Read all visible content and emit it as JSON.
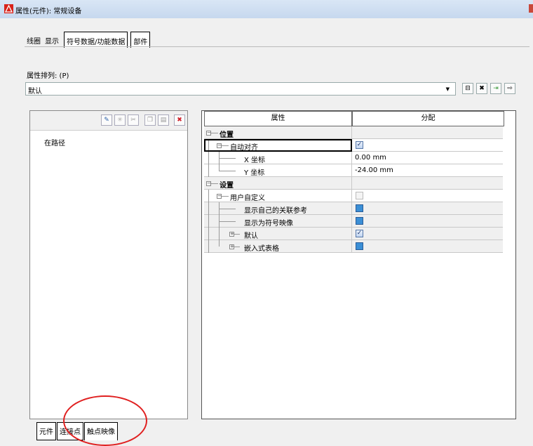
{
  "window": {
    "title": "属性(元件): 常规设备"
  },
  "tabs": [
    {
      "label": "线圈"
    },
    {
      "label": "显示"
    },
    {
      "label": "符号数据/功能数据"
    },
    {
      "label": "部件"
    }
  ],
  "attribute_sort": {
    "label": "属性排列: (P)",
    "value": "默认"
  },
  "left_panel": {
    "items": [
      "在路径"
    ]
  },
  "grid": {
    "headers": [
      "属性",
      "分配"
    ],
    "rows": [
      {
        "label": "位置",
        "value": ""
      },
      {
        "label": "自动对齐",
        "value": "✓"
      },
      {
        "label": "X 坐标",
        "value": "0.00 mm"
      },
      {
        "label": "Y 坐标",
        "value": "-24.00 mm"
      },
      {
        "label": "设置",
        "value": ""
      },
      {
        "label": "用户自定义",
        "value": ""
      },
      {
        "label": "显示自己的关联参考",
        "value": ""
      },
      {
        "label": "显示为符号映像",
        "value": ""
      },
      {
        "label": "默认",
        "value": "✓"
      },
      {
        "label": "嵌入式表格",
        "value": ""
      }
    ]
  },
  "bottom_tabs": [
    {
      "label": "元件"
    },
    {
      "label": "连接点"
    },
    {
      "label": "触点映像"
    }
  ],
  "colors": {
    "annotation": "#e02020",
    "checkbox_blue": "#3b8fd6"
  }
}
